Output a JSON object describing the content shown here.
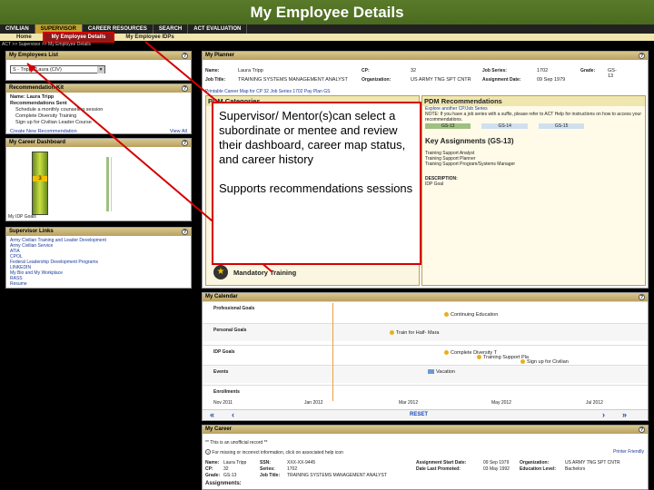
{
  "slide_title": "My Employee Details",
  "tabs": [
    "CIVILIAN",
    "SUPERVISOR",
    "CAREER RESOURCES",
    "SEARCH",
    "ACT EVALUATION"
  ],
  "subnav": [
    "Home",
    "My Employee Details",
    "My Employee IDPs"
  ],
  "breadcrumb": "ACT >> Supervisor >> My Employee Details",
  "employees": {
    "title": "My Employees List",
    "selected": "S - Tripp , Laura (CIV)"
  },
  "reco_kit": {
    "title": "Recommendation Kit",
    "name": "Name: Laura Tripp",
    "sent": "Recommendations Sent",
    "items": [
      "Schedule a monthly counseling session",
      "Complete Diversity Training",
      "Sign up for Civilian Leader Course"
    ],
    "new": "Create New Recommendation",
    "view_all": "View All"
  },
  "dashboard": {
    "title": "My Career Dashboard",
    "idp": "My IDP Goals",
    "value": "3"
  },
  "sup_links": {
    "title": "Supervisor Links",
    "items": [
      "Army Civilian Training and Leader Development",
      "Army Civilian Service",
      "ATIA",
      "CPOL",
      "Federal Leadership Development Programs",
      "LINKEDIN",
      "My Bio and My Workplace",
      "RASS",
      "Resume"
    ]
  },
  "planner": {
    "title": "My Planner",
    "name_label": "Name:",
    "name": "Laura Tripp",
    "cp_label": "CP:",
    "cp": "32",
    "series_label": "Job Series:",
    "series": "1702",
    "grade_label": "Grade:",
    "grade": "GS-13",
    "jobtitle_label": "Job Title:",
    "jobtitle": "TRAINING SYSTEMS MANAGEMENT ANALYST",
    "org_label": "Organization:",
    "org": "US ARMY TNG SPT CNTR",
    "assign_label": "Assignment Date:",
    "assign": "09 Sep 1979",
    "map_link": "Printable Career Map for CP 32 Job Series 1702 Pay Plan GS",
    "pdm_cat": "PDM Categories",
    "pdm_reco": "PDM Recommendations",
    "reco_text1": "Explore another CP/Job Series",
    "reco_text2": "NOTE: If you have a job series with a suffix, please refer to ACT Help for instructions on how to access your recommendations.",
    "gs": [
      "GS-13",
      "GS-14",
      "GS-15"
    ],
    "assignments": "Key Assignments (GS-13)",
    "assign_items": [
      "Training Support Analyst",
      "Training Support Planner",
      "Training Support Program/Systems Manager"
    ],
    "desc": "DESCRIPTION:",
    "idp_goal": "IDP Goal",
    "mandatory": "Mandatory Training"
  },
  "callout": {
    "p1": "Supervisor/ Mentor(s)can select a subordinate or mentee and review their dashboard, career map status, and career history",
    "p2": "Supports recommendations sessions"
  },
  "calendar": {
    "title": "My Calendar",
    "rows": [
      "Professional Goals",
      "Personal Goals",
      "IDP Goals",
      "Events",
      "Enrollments"
    ],
    "events": [
      "Continuing Education",
      "Train for Half- Mara",
      "Complete Diversity T",
      "Training Support Pla",
      "Sign up for Civilian",
      "Vacation"
    ],
    "months": [
      "Nov 2011",
      "Jan 2012",
      "Mar 2012",
      "May 2012",
      "Jul 2012"
    ],
    "reset": "RESET"
  },
  "career": {
    "title": "My Career",
    "note": "** This is an unofficial record **",
    "help": "For missing or incorrect information, click on associated help icon",
    "printer": "Printer Friendly",
    "name_label": "Name:",
    "name": "Laura Tripp",
    "ssn_label": "SSN:",
    "ssn": "XXX-XX-9445",
    "start_label": "Assignment Start Date:",
    "start": "09 Sep 1979",
    "org_label": "Organization:",
    "org": "US ARMY TNG SPT CNTR",
    "cp_label": "CP:",
    "cp": "32",
    "series_label": "Series:",
    "series": "1702",
    "promo_label": "Date Last Promoted:",
    "promo": "03 May 1992",
    "edu_label": "Education Level:",
    "edu": "Bachelors",
    "grade_label": "Grade:",
    "grade": "GS-13",
    "jt_label": "Job Title:",
    "jt": "TRAINING SYSTEMS MANAGEMENT ANALYST",
    "assignments": "Assignments:"
  }
}
